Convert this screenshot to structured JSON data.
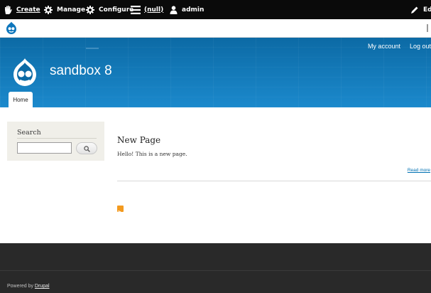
{
  "toolbar": {
    "create_label": "Create",
    "manage_label": "Manage",
    "configure_label": "Configure",
    "shortcuts_label": "(null)",
    "user_label": "admin",
    "edit_label": "Edit"
  },
  "header": {
    "site_name": "sandbox 8",
    "secondary_nav": [
      "My account",
      "Log out"
    ],
    "primary_tab": "Home"
  },
  "sidebar": {
    "search_title": "Search",
    "search_value": ""
  },
  "main": {
    "node_title": "New Page",
    "node_body": "Hello! This is a new page.",
    "read_more": "Read more"
  },
  "footer": {
    "powered_prefix": "Powered by ",
    "powered_link": "Drupal"
  },
  "colors": {
    "toolbar_bg": "#0a0a0a",
    "header_blue": "#1b89cc",
    "link_blue": "#0071b3",
    "footer_bg": "#292929",
    "rss_orange": "#f39a1f"
  }
}
